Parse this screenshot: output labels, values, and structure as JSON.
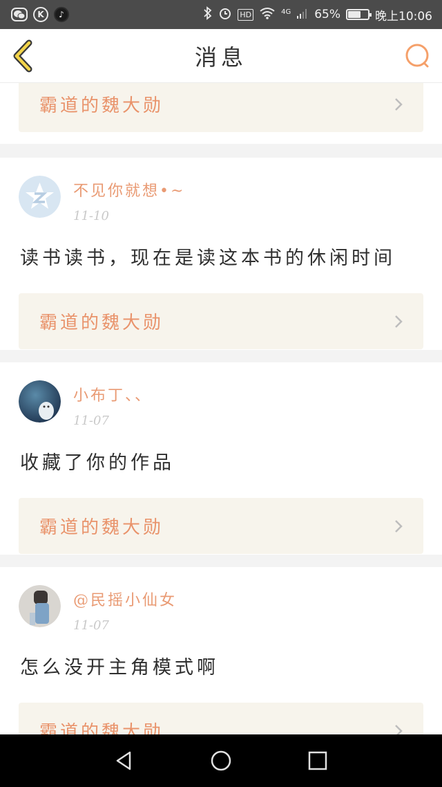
{
  "status_bar": {
    "icons": [
      "wechat-icon",
      "k-icon",
      "tiktok-icon",
      "bluetooth-icon",
      "alarm-icon",
      "hd-icon",
      "wifi-icon",
      "signal-icon",
      "battery-icon"
    ],
    "hd_label": "HD",
    "network": "4G",
    "battery_percent": "65%",
    "battery_level": 0.65,
    "time": "晚上10:06"
  },
  "nav": {
    "title": "消息",
    "back_icon": "back-chevron-icon",
    "search_icon": "search-icon",
    "accent_color": "#f5a06a"
  },
  "messages": [
    {
      "username": "",
      "date": "",
      "text": "",
      "book_title": "霸道的魏大勋"
    },
    {
      "username": "不见你就想•~",
      "date": "11-10",
      "text": "读书读书，现在是读这本书的休闲时间",
      "book_title": "霸道的魏大勋"
    },
    {
      "username": "小布丁、、",
      "date": "11-07",
      "text": "收藏了你的作品",
      "book_title": "霸道的魏大勋"
    },
    {
      "username": "@民摇小仙女",
      "date": "11-07",
      "text": "怎么没开主角模式啊",
      "book_title": "霸道的魏大勋"
    }
  ],
  "colors": {
    "book_link_bg": "#f7f4ec",
    "book_title": "#e9936b",
    "username": "#e99a73"
  },
  "system_nav": [
    "back-triangle-icon",
    "home-circle-icon",
    "recents-square-icon"
  ]
}
